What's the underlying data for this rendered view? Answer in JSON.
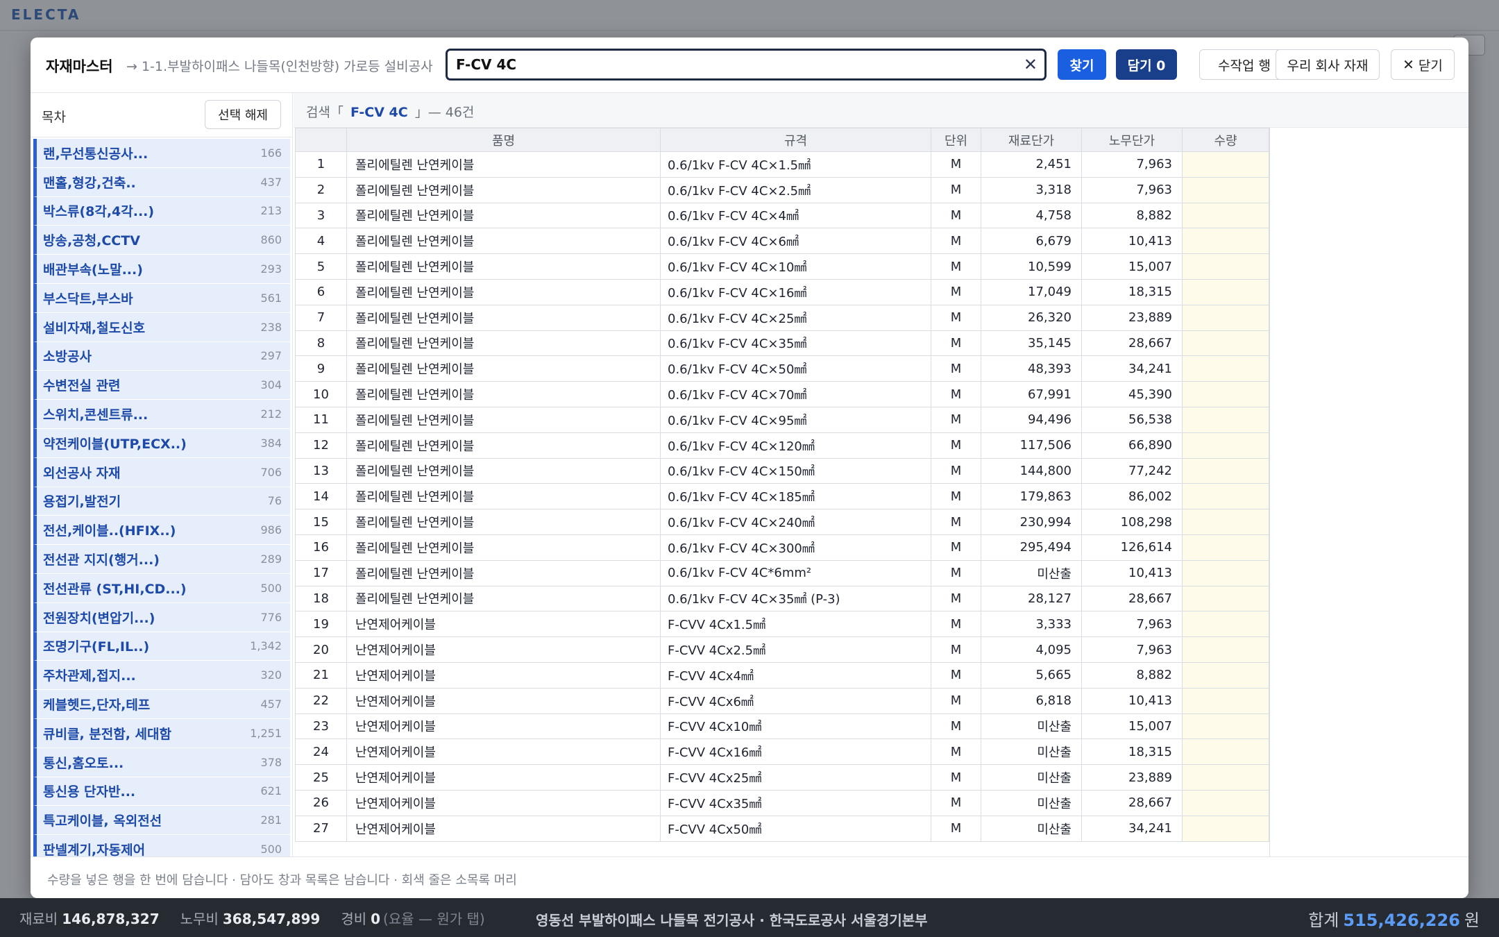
{
  "app": {
    "logo": "ELECTA"
  },
  "modal": {
    "title": "자재마스터",
    "subtitle": "→ 1-1.부발하이패스 나들목(인천방향) 가로등 설비공사",
    "search": {
      "value": "F-CV 4C",
      "placeholder": ""
    },
    "buttons": {
      "find": "찾기",
      "cart": "담기 0",
      "manual_row": "수작업 행",
      "company_material": "우리 회사 자재",
      "close": "닫기"
    },
    "sidebar": {
      "title": "목차",
      "clear_label": "선택 해제",
      "items": [
        {
          "label": "랜,무선통신공사...",
          "count": "166"
        },
        {
          "label": "맨홀,형강,건축..",
          "count": "437"
        },
        {
          "label": "박스류(8각,4각...)",
          "count": "213"
        },
        {
          "label": "방송,공청,CCTV",
          "count": "860"
        },
        {
          "label": "배관부속(노말...)",
          "count": "293"
        },
        {
          "label": "부스닥트,부스바",
          "count": "561"
        },
        {
          "label": "설비자재,철도신호",
          "count": "238"
        },
        {
          "label": "소방공사",
          "count": "297"
        },
        {
          "label": "수변전실 관련",
          "count": "304"
        },
        {
          "label": "스위치,콘센트류...",
          "count": "212"
        },
        {
          "label": "약전케이블(UTP,ECX..)",
          "count": "384"
        },
        {
          "label": "외선공사 자재",
          "count": "706"
        },
        {
          "label": "용접기,발전기",
          "count": "76"
        },
        {
          "label": "전선,케이블..(HFIX..)",
          "count": "986"
        },
        {
          "label": "전선관 지지(행거...)",
          "count": "289"
        },
        {
          "label": "전선관류 (ST,HI,CD...)",
          "count": "500"
        },
        {
          "label": "전원장치(변압기...)",
          "count": "776"
        },
        {
          "label": "조명기구(FL,IL..)",
          "count": "1,342"
        },
        {
          "label": "주차관제,접지...",
          "count": "320"
        },
        {
          "label": "케블헷드,단자,테프",
          "count": "457"
        },
        {
          "label": "큐비클, 분전함, 세대함",
          "count": "1,251"
        },
        {
          "label": "통신,홈오토...",
          "count": "378"
        },
        {
          "label": "통신용 단자반...",
          "count": "621"
        },
        {
          "label": "특고케이블, 옥외전선",
          "count": "281"
        },
        {
          "label": "판넬계기,자동제어",
          "count": "500"
        }
      ]
    },
    "result": {
      "prefix": "검색「",
      "query": "F-CV 4C",
      "suffix": "」— 46건"
    },
    "table": {
      "headers": {
        "name": "품명",
        "spec": "규격",
        "unit": "단위",
        "material_price": "재료단가",
        "labor_price": "노무단가",
        "qty": "수량"
      },
      "rows": [
        {
          "no": "1",
          "name": "폴리에틸렌 난연케이블",
          "spec": "0.6/1kv F-CV 4C×1.5㎟",
          "unit": "M",
          "mat": "2,451",
          "lab": "7,963"
        },
        {
          "no": "2",
          "name": "폴리에틸렌 난연케이블",
          "spec": "0.6/1kv F-CV 4C×2.5㎟",
          "unit": "M",
          "mat": "3,318",
          "lab": "7,963"
        },
        {
          "no": "3",
          "name": "폴리에틸렌 난연케이블",
          "spec": "0.6/1kv F-CV 4C×4㎟",
          "unit": "M",
          "mat": "4,758",
          "lab": "8,882"
        },
        {
          "no": "4",
          "name": "폴리에틸렌 난연케이블",
          "spec": "0.6/1kv F-CV 4C×6㎟",
          "unit": "M",
          "mat": "6,679",
          "lab": "10,413"
        },
        {
          "no": "5",
          "name": "폴리에틸렌 난연케이블",
          "spec": "0.6/1kv F-CV 4C×10㎟",
          "unit": "M",
          "mat": "10,599",
          "lab": "15,007"
        },
        {
          "no": "6",
          "name": "폴리에틸렌 난연케이블",
          "spec": "0.6/1kv F-CV 4C×16㎟",
          "unit": "M",
          "mat": "17,049",
          "lab": "18,315"
        },
        {
          "no": "7",
          "name": "폴리에틸렌 난연케이블",
          "spec": "0.6/1kv F-CV 4C×25㎟",
          "unit": "M",
          "mat": "26,320",
          "lab": "23,889"
        },
        {
          "no": "8",
          "name": "폴리에틸렌 난연케이블",
          "spec": "0.6/1kv F-CV 4C×35㎟",
          "unit": "M",
          "mat": "35,145",
          "lab": "28,667"
        },
        {
          "no": "9",
          "name": "폴리에틸렌 난연케이블",
          "spec": "0.6/1kv F-CV 4C×50㎟",
          "unit": "M",
          "mat": "48,393",
          "lab": "34,241"
        },
        {
          "no": "10",
          "name": "폴리에틸렌 난연케이블",
          "spec": "0.6/1kv F-CV 4C×70㎟",
          "unit": "M",
          "mat": "67,991",
          "lab": "45,390"
        },
        {
          "no": "11",
          "name": "폴리에틸렌 난연케이블",
          "spec": "0.6/1kv F-CV 4C×95㎟",
          "unit": "M",
          "mat": "94,496",
          "lab": "56,538"
        },
        {
          "no": "12",
          "name": "폴리에틸렌 난연케이블",
          "spec": "0.6/1kv F-CV 4C×120㎟",
          "unit": "M",
          "mat": "117,506",
          "lab": "66,890"
        },
        {
          "no": "13",
          "name": "폴리에틸렌 난연케이블",
          "spec": "0.6/1kv F-CV 4C×150㎟",
          "unit": "M",
          "mat": "144,800",
          "lab": "77,242"
        },
        {
          "no": "14",
          "name": "폴리에틸렌 난연케이블",
          "spec": "0.6/1kv F-CV 4C×185㎟",
          "unit": "M",
          "mat": "179,863",
          "lab": "86,002"
        },
        {
          "no": "15",
          "name": "폴리에틸렌 난연케이블",
          "spec": "0.6/1kv F-CV 4C×240㎟",
          "unit": "M",
          "mat": "230,994",
          "lab": "108,298"
        },
        {
          "no": "16",
          "name": "폴리에틸렌 난연케이블",
          "spec": "0.6/1kv F-CV 4C×300㎟",
          "unit": "M",
          "mat": "295,494",
          "lab": "126,614"
        },
        {
          "no": "17",
          "name": "폴리에틸렌 난연케이블",
          "spec": "0.6/1kv F-CV 4C*6mm²",
          "unit": "M",
          "mat": "미산출",
          "lab": "10,413"
        },
        {
          "no": "18",
          "name": "폴리에틸렌 난연케이블",
          "spec": "0.6/1kv F-CV 4C×35㎟ (P-3)",
          "unit": "M",
          "mat": "28,127",
          "lab": "28,667"
        },
        {
          "no": "19",
          "name": "난연제어케이블",
          "spec": "F-CVV 4Cx1.5㎟",
          "unit": "M",
          "mat": "3,333",
          "lab": "7,963"
        },
        {
          "no": "20",
          "name": "난연제어케이블",
          "spec": "F-CVV 4Cx2.5㎟",
          "unit": "M",
          "mat": "4,095",
          "lab": "7,963"
        },
        {
          "no": "21",
          "name": "난연제어케이블",
          "spec": "F-CVV 4Cx4㎟",
          "unit": "M",
          "mat": "5,665",
          "lab": "8,882"
        },
        {
          "no": "22",
          "name": "난연제어케이블",
          "spec": "F-CVV 4Cx6㎟",
          "unit": "M",
          "mat": "6,818",
          "lab": "10,413"
        },
        {
          "no": "23",
          "name": "난연제어케이블",
          "spec": "F-CVV 4Cx10㎟",
          "unit": "M",
          "mat": "미산출",
          "lab": "15,007"
        },
        {
          "no": "24",
          "name": "난연제어케이블",
          "spec": "F-CVV 4Cx16㎟",
          "unit": "M",
          "mat": "미산출",
          "lab": "18,315"
        },
        {
          "no": "25",
          "name": "난연제어케이블",
          "spec": "F-CVV 4Cx25㎟",
          "unit": "M",
          "mat": "미산출",
          "lab": "23,889"
        },
        {
          "no": "26",
          "name": "난연제어케이블",
          "spec": "F-CVV 4Cx35㎟",
          "unit": "M",
          "mat": "미산출",
          "lab": "28,667"
        },
        {
          "no": "27",
          "name": "난연제어케이블",
          "spec": "F-CVV 4Cx50㎟",
          "unit": "M",
          "mat": "미산출",
          "lab": "34,241"
        }
      ]
    },
    "footer": "수량을 넣은 행을 한 번에 담습니다 · 담아도 창과 목록은 남습니다 · 회색 줄은 소목록 머리"
  },
  "bottom_bar": {
    "material_label": "재료비",
    "material_value": "146,878,327",
    "labor_label": "노무비",
    "labor_value": "368,547,899",
    "expense_label": "경비",
    "expense_value": "0",
    "expense_note": "(요율 — 원가 탭)",
    "project": "영동선 부발하이패스 나들목 전기공사 · 한국도로공사 서울경기본부",
    "total_label": "합계",
    "total_value": "515,426,226",
    "total_unit": "원"
  },
  "colors": {
    "primary": "#1a5fe0",
    "navy": "#1a3f8a",
    "sidebar_active_bg": "#e6eefb",
    "sidebar_accent": "#2d5fd1",
    "qty_cell": "#fffbea",
    "total_accent": "#5b9cf6"
  }
}
